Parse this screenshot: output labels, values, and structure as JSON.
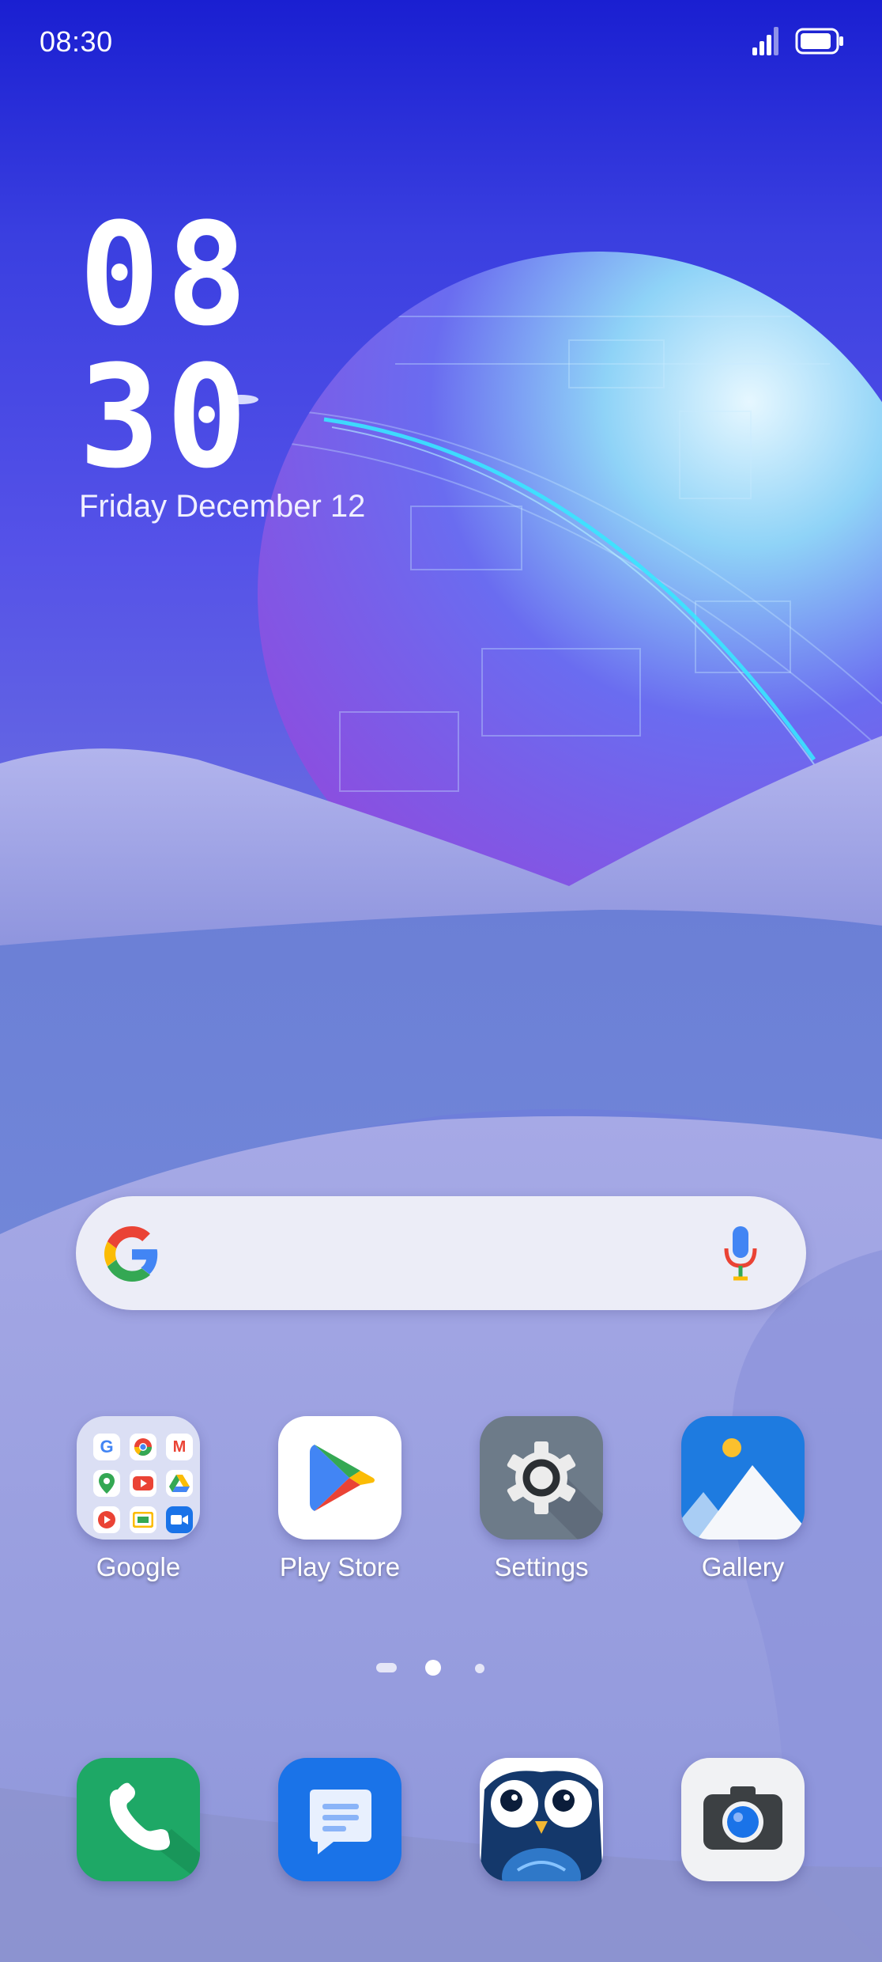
{
  "status_bar": {
    "time": "08:30",
    "signal_icon": "signal-icon",
    "battery_icon": "battery-icon"
  },
  "clock_widget": {
    "hours": "08",
    "minutes": "30",
    "date": "Friday December 12"
  },
  "search": {
    "logo_icon": "google-g-icon",
    "mic_icon": "microphone-icon"
  },
  "home_apps": [
    {
      "label": "Google",
      "icon": "google-folder-icon"
    },
    {
      "label": "Play Store",
      "icon": "play-store-icon"
    },
    {
      "label": "Settings",
      "icon": "gear-icon"
    },
    {
      "label": "Gallery",
      "icon": "gallery-icon"
    }
  ],
  "page_indicator": {
    "pages": 3,
    "current": 2
  },
  "dock_apps": [
    {
      "icon": "phone-icon"
    },
    {
      "icon": "messages-icon"
    },
    {
      "icon": "owl-app-icon"
    },
    {
      "icon": "camera-icon"
    }
  ],
  "colors": {
    "sky_top": "#1a1fd1",
    "dune": "#a9abe6",
    "planet": "#7a5cf0",
    "google_blue": "#4285F4",
    "google_red": "#EA4335",
    "google_yellow": "#FBBC05",
    "google_green": "#34A853"
  }
}
